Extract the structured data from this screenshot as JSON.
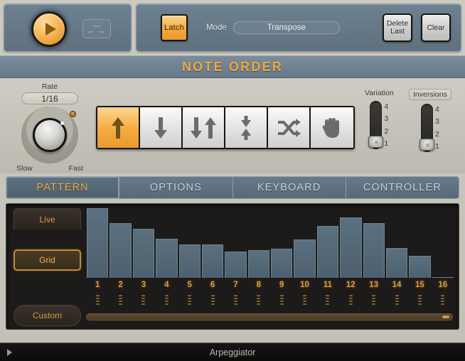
{
  "transport": {
    "play_icon": "play-triangle-icon",
    "midi_icon": "midi-activity-icon",
    "latch_label": "Latch",
    "mode_label": "Mode",
    "mode_value": "Transpose",
    "delete_last_line1": "Delete",
    "delete_last_line2": "Last",
    "clear_label": "Clear"
  },
  "note_order": {
    "title": "NOTE ORDER",
    "rate_label": "Rate",
    "rate_value": "1/16",
    "knob_min_label": "Slow",
    "knob_max_label": "Fast",
    "directions": [
      {
        "name": "up",
        "icon": "arrow-up-icon",
        "selected": true
      },
      {
        "name": "down",
        "icon": "arrow-down-icon",
        "selected": false
      },
      {
        "name": "down-up",
        "icon": "arrow-down-up-icon",
        "selected": false
      },
      {
        "name": "up-down",
        "icon": "arrows-converge-icon",
        "selected": false
      },
      {
        "name": "random",
        "icon": "shuffle-icon",
        "selected": false
      },
      {
        "name": "as-played",
        "icon": "hand-icon",
        "selected": false
      }
    ],
    "variation": {
      "label": "Variation",
      "scale": [
        "4",
        "3",
        "2",
        "1"
      ],
      "value": 1
    },
    "inversions": {
      "label": "Inversions",
      "scale": [
        "4",
        "3",
        "2",
        "1"
      ],
      "value": 1
    }
  },
  "tabs": [
    {
      "label": "PATTERN",
      "active": true
    },
    {
      "label": "OPTIONS",
      "active": false
    },
    {
      "label": "KEYBOARD",
      "active": false
    },
    {
      "label": "CONTROLLER",
      "active": false
    }
  ],
  "pattern": {
    "mode_buttons": [
      {
        "label": "Live",
        "selected": false
      },
      {
        "label": "Grid",
        "selected": true
      },
      {
        "label": "Custom",
        "selected": false
      }
    ]
  },
  "chart_data": {
    "type": "bar",
    "title": "",
    "xlabel": "",
    "ylabel": "",
    "grid": false,
    "ylim": [
      0,
      100
    ],
    "categories": [
      "1",
      "2",
      "3",
      "4",
      "5",
      "6",
      "7",
      "8",
      "9",
      "10",
      "11",
      "12",
      "13",
      "14",
      "15",
      "16"
    ],
    "values": [
      100,
      79,
      70,
      56,
      48,
      48,
      38,
      40,
      42,
      55,
      74,
      87,
      79,
      43,
      32,
      1
    ]
  },
  "footer": {
    "title": "Arpeggiator",
    "expand_icon": "play-triangle-small-icon"
  }
}
